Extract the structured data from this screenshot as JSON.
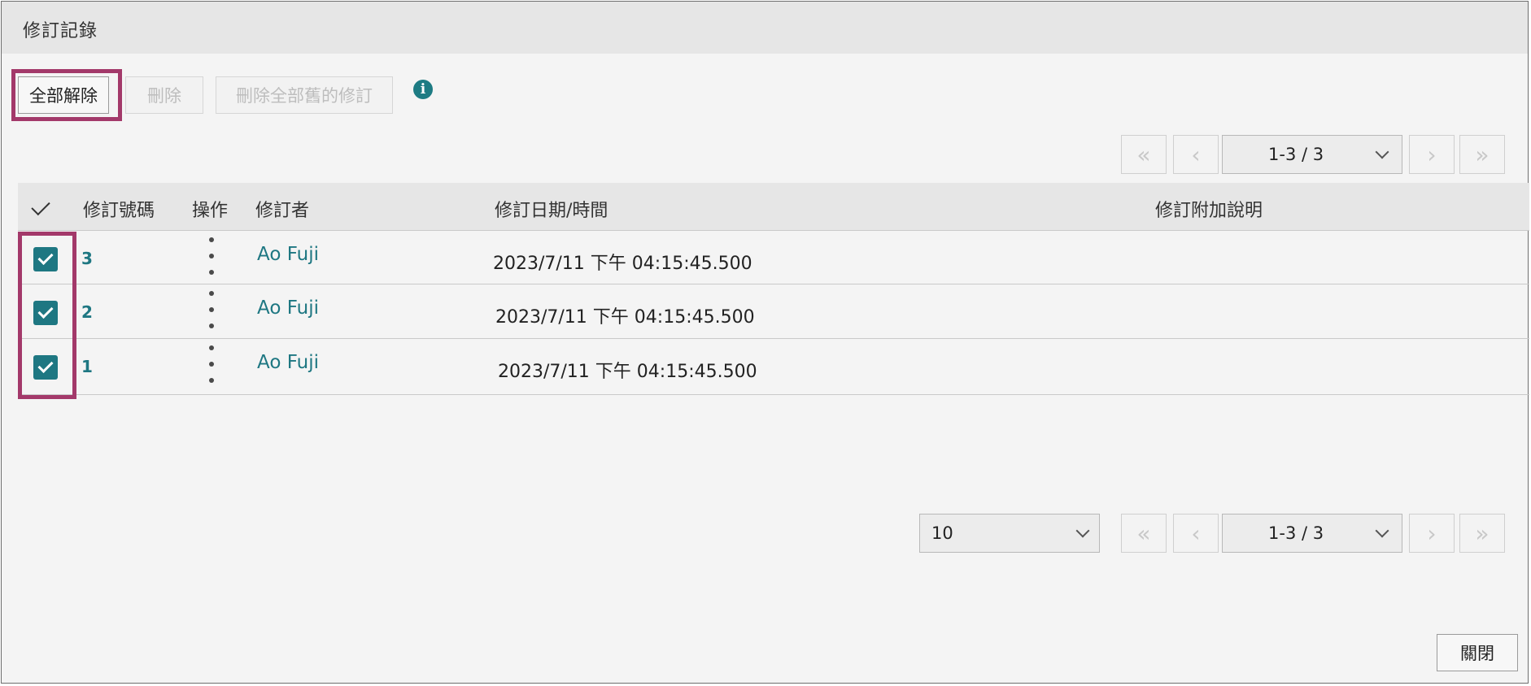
{
  "dialog": {
    "title": "修訂記錄"
  },
  "toolbar": {
    "release_all_label": "全部解除",
    "delete_label": "刪除",
    "delete_all_label": "刪除全部舊的修訂",
    "info_icon": "i"
  },
  "pager_top": {
    "range": "1-3 / 3"
  },
  "pager_bottom": {
    "page_size": "10",
    "range": "1-3 / 3"
  },
  "pager_glyphs": {
    "first": "«",
    "prev": "‹",
    "next": "›",
    "last": "»"
  },
  "table": {
    "headers": {
      "number": "修訂號碼",
      "action": "操作",
      "author": "修訂者",
      "datetime": "修訂日期/時間",
      "note": "修訂附加說明"
    },
    "rows": [
      {
        "number": "3",
        "author": "Ao Fuji",
        "datetime": "2023/7/11 下午 04:15:45.500",
        "note": ""
      },
      {
        "number": "2",
        "author": "Ao Fuji",
        "datetime": "2023/7/11 下午 04:15:45.500",
        "note": ""
      },
      {
        "number": "1",
        "author": "Ao Fuji",
        "datetime": "2023/7/11 下午 04:15:45.500",
        "note": ""
      }
    ]
  },
  "footer": {
    "close_label": "關閉"
  },
  "colors": {
    "accent": "#1e7782",
    "highlight": "#a3396a"
  }
}
